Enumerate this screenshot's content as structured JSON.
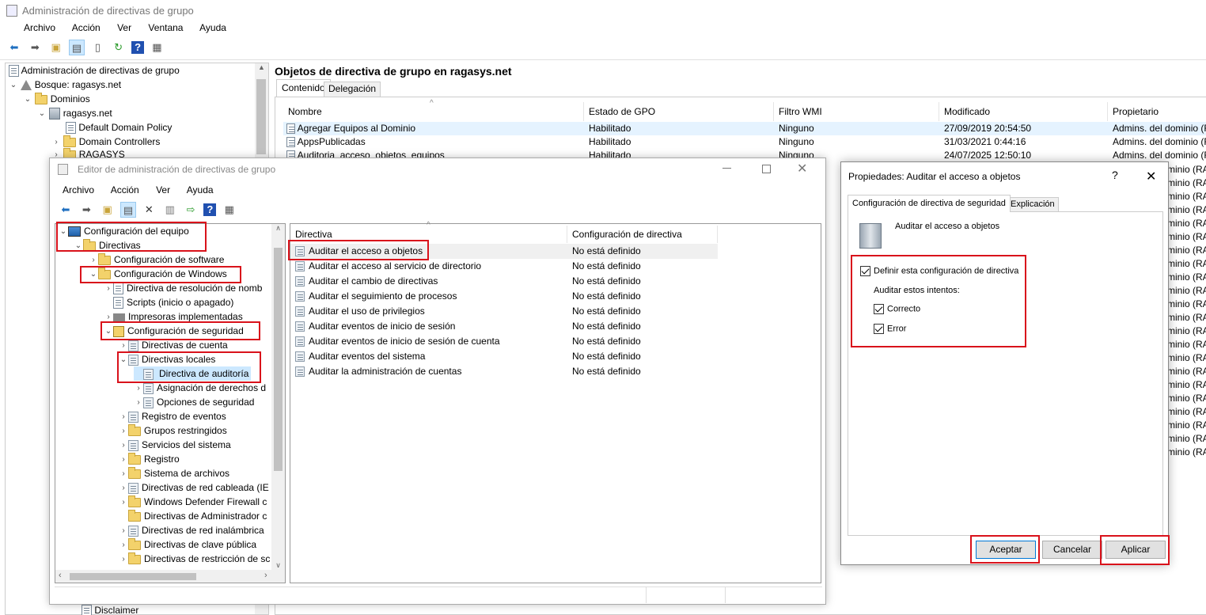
{
  "main_window": {
    "title": "Administración de directivas de grupo",
    "menu": [
      "Archivo",
      "Acción",
      "Ver",
      "Ventana",
      "Ayuda"
    ],
    "tree": {
      "root": "Administración de directivas de grupo",
      "forest": "Bosque: ragasys.net",
      "domains": "Dominios",
      "domain": "ragasys.net",
      "items": [
        "Default Domain Policy",
        "Domain Controllers",
        "RAGASYS"
      ],
      "bottom_item": "Disclaimer"
    },
    "content_title": "Objetos de directiva de grupo en ragasys.net",
    "tabs": [
      "Contenido",
      "Delegación"
    ],
    "columns": [
      "Nombre",
      "Estado de GPO",
      "Filtro WMI",
      "Modificado",
      "Propietario"
    ],
    "rows": [
      {
        "name": "Agregar Equipos al Dominio",
        "status": "Habilitado",
        "wmi": "Ninguno",
        "modified": "27/09/2019 20:54:50",
        "owner": "Admins. del dominio (RAG"
      },
      {
        "name": "AppsPublicadas",
        "status": "Habilitado",
        "wmi": "Ninguno",
        "modified": "31/03/2021 0:44:16",
        "owner": "Admins. del dominio (RAG"
      },
      {
        "name": "Auditoria_acceso_objetos_equipos",
        "status": "Habilitado",
        "wmi": "Ninguno",
        "modified": "24/07/2025 12:50:10",
        "owner": "Admins. del dominio (RAG"
      }
    ],
    "owner_repeat": "minio (RAG"
  },
  "editor_window": {
    "title": "Editor de administración de directivas de grupo",
    "menu": [
      "Archivo",
      "Acción",
      "Ver",
      "Ayuda"
    ],
    "tree": [
      {
        "label": "Configuración del equipo",
        "indent": 0,
        "chev": "v",
        "icon": "computer"
      },
      {
        "label": "Directivas",
        "indent": 1,
        "chev": "v",
        "icon": "folder"
      },
      {
        "label": "Configuración de software",
        "indent": 2,
        "chev": ">",
        "icon": "folder"
      },
      {
        "label": "Configuración de Windows",
        "indent": 2,
        "chev": "v",
        "icon": "folder"
      },
      {
        "label": "Directiva de resolución de nomb",
        "indent": 3,
        "chev": ">",
        "icon": "gpo"
      },
      {
        "label": "Scripts (inicio o apagado)",
        "indent": 3,
        "chev": "",
        "icon": "gpo"
      },
      {
        "label": "Impresoras implementadas",
        "indent": 3,
        "chev": ">",
        "icon": "printer"
      },
      {
        "label": "Configuración de seguridad",
        "indent": 3,
        "chev": "v",
        "icon": "security"
      },
      {
        "label": "Directivas de cuenta",
        "indent": 4,
        "chev": ">",
        "icon": "pol"
      },
      {
        "label": "Directivas locales",
        "indent": 4,
        "chev": "v",
        "icon": "pol"
      },
      {
        "label": "Directiva de auditoría",
        "indent": 5,
        "chev": "",
        "icon": "pol",
        "selected": true
      },
      {
        "label": "Asignación de derechos d",
        "indent": 5,
        "chev": ">",
        "icon": "pol"
      },
      {
        "label": "Opciones de seguridad",
        "indent": 5,
        "chev": ">",
        "icon": "pol"
      },
      {
        "label": "Registro de eventos",
        "indent": 4,
        "chev": ">",
        "icon": "pol"
      },
      {
        "label": "Grupos restringidos",
        "indent": 4,
        "chev": ">",
        "icon": "folder"
      },
      {
        "label": "Servicios del sistema",
        "indent": 4,
        "chev": ">",
        "icon": "pol"
      },
      {
        "label": "Registro",
        "indent": 4,
        "chev": ">",
        "icon": "folder"
      },
      {
        "label": "Sistema de archivos",
        "indent": 4,
        "chev": ">",
        "icon": "folder"
      },
      {
        "label": "Directivas de red cableada (IE",
        "indent": 4,
        "chev": ">",
        "icon": "pol"
      },
      {
        "label": "Windows Defender Firewall c",
        "indent": 4,
        "chev": ">",
        "icon": "folder"
      },
      {
        "label": "Directivas de Administrador c",
        "indent": 4,
        "chev": "",
        "icon": "folder"
      },
      {
        "label": "Directivas de red inalámbrica",
        "indent": 4,
        "chev": ">",
        "icon": "pol"
      },
      {
        "label": "Directivas de clave pública",
        "indent": 4,
        "chev": ">",
        "icon": "folder"
      },
      {
        "label": "Directivas de restricción de sc",
        "indent": 4,
        "chev": ">",
        "icon": "folder"
      }
    ],
    "columns": [
      "Directiva",
      "Configuración de directiva"
    ],
    "policies": [
      {
        "name": "Auditar el acceso a objetos",
        "value": "No está definido"
      },
      {
        "name": "Auditar el acceso al servicio de directorio",
        "value": "No está definido"
      },
      {
        "name": "Auditar el cambio de directivas",
        "value": "No está definido"
      },
      {
        "name": "Auditar el seguimiento de procesos",
        "value": "No está definido"
      },
      {
        "name": "Auditar el uso de privilegios",
        "value": "No está definido"
      },
      {
        "name": "Auditar eventos de inicio de sesión",
        "value": "No está definido"
      },
      {
        "name": "Auditar eventos de inicio de sesión de cuenta",
        "value": "No está definido"
      },
      {
        "name": "Auditar eventos del sistema",
        "value": "No está definido"
      },
      {
        "name": "Auditar la administración de cuentas",
        "value": "No está definido"
      }
    ]
  },
  "dialog": {
    "title": "Propiedades: Auditar el acceso a objetos",
    "help": "?",
    "close": "✕",
    "tabs": [
      "Configuración de directiva de seguridad",
      "Explicación"
    ],
    "policy_name": "Auditar el acceso a objetos",
    "define_label": "Definir esta configuración de directiva",
    "attempts_label": "Auditar estos intentos:",
    "success_label": "Correcto",
    "failure_label": "Error",
    "define_checked": true,
    "success_checked": true,
    "failure_checked": true,
    "buttons": {
      "ok": "Aceptar",
      "cancel": "Cancelar",
      "apply": "Aplicar"
    }
  },
  "colors": {
    "highlight": "#d9121b",
    "selection": "#cce8ff",
    "accent": "#0078d7"
  }
}
